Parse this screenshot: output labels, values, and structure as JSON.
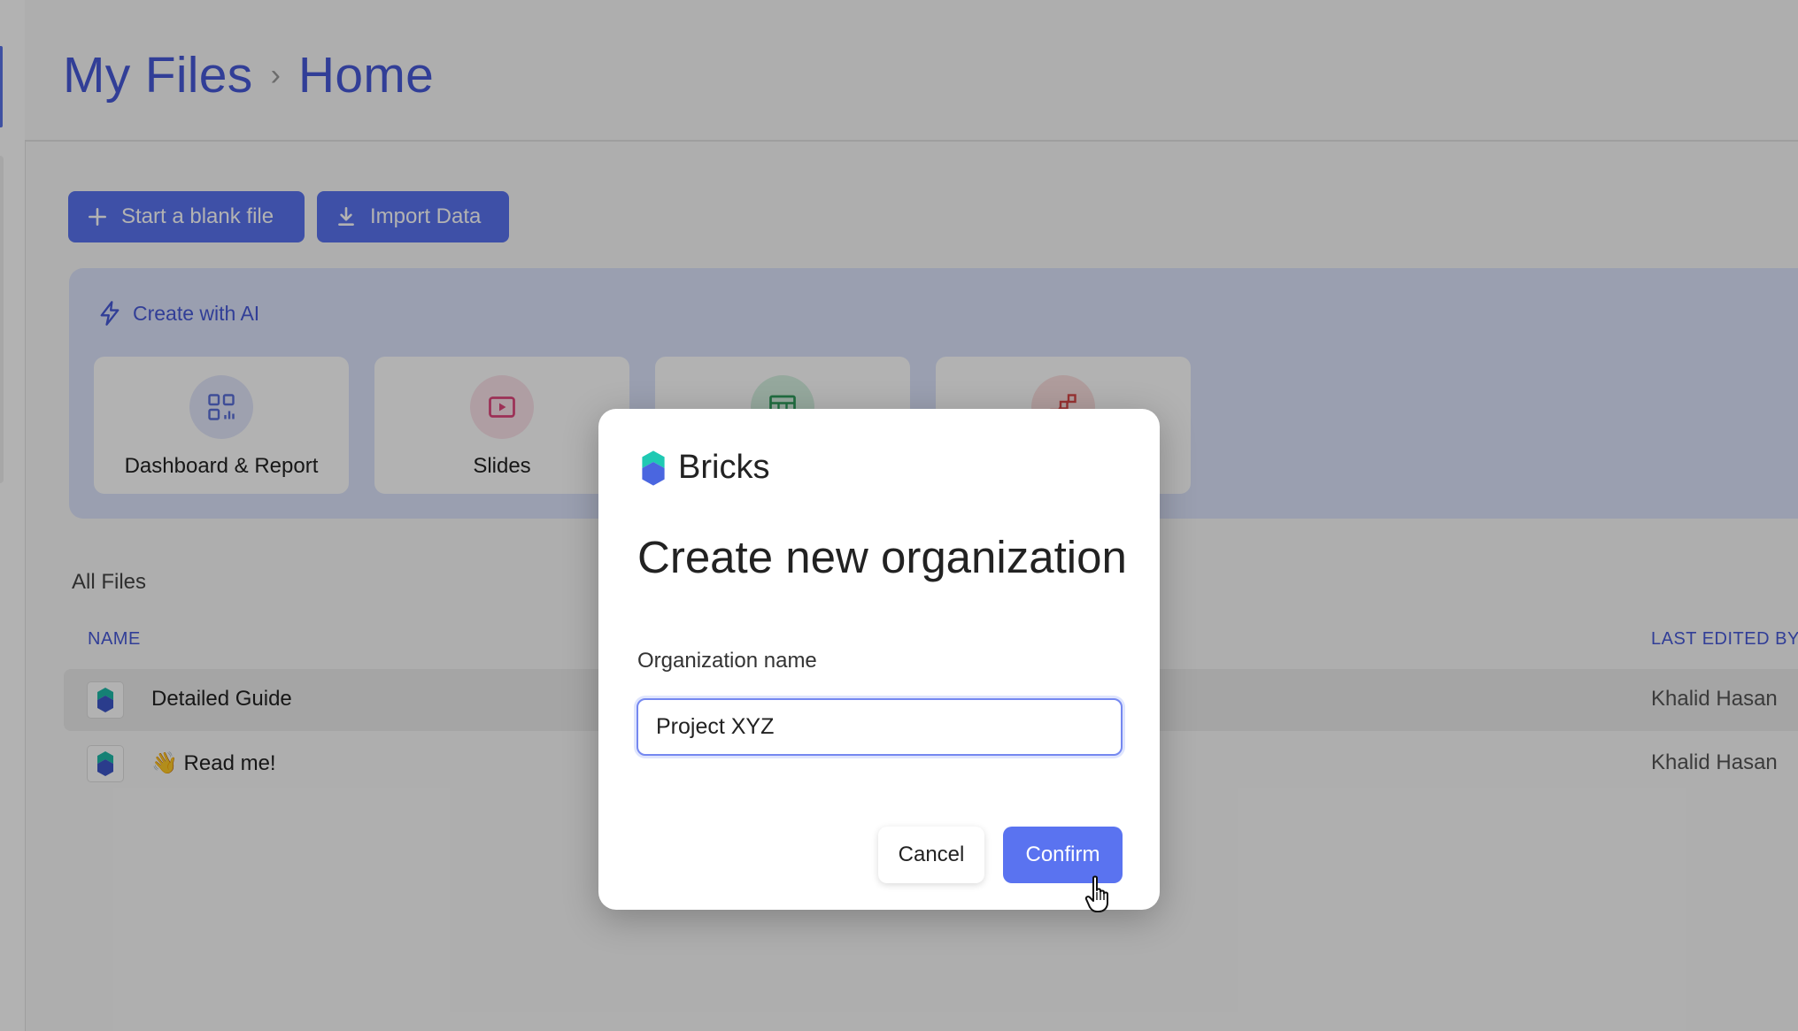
{
  "header": {
    "breadcrumb": [
      "My Files",
      "Home"
    ],
    "separator": "›"
  },
  "toolbar": {
    "blank_file_label": "Start a blank file",
    "import_label": "Import Data"
  },
  "ai_section": {
    "title": "Create with AI",
    "cards": [
      {
        "label": "Dashboard & Report",
        "icon": "dashboard-icon",
        "color": "#5a6fd8"
      },
      {
        "label": "Slides",
        "icon": "slides-icon",
        "color": "#e0457b"
      },
      {
        "label": "",
        "icon": "table-icon",
        "color": "#2e9c5c"
      },
      {
        "label": "",
        "icon": "flow-icon",
        "color": "#d94848"
      }
    ]
  },
  "files": {
    "section_title": "All Files",
    "columns": {
      "name": "NAME",
      "last_edited_by": "LAST EDITED BY"
    },
    "rows": [
      {
        "name": "Detailed Guide",
        "last_edited_by": "Khalid Hasan"
      },
      {
        "name": "👋 Read me!",
        "last_edited_by": "Khalid Hasan"
      }
    ]
  },
  "modal": {
    "brand": "Bricks",
    "title": "Create new organization",
    "field_label": "Organization name",
    "field_value": "Project XYZ",
    "cancel_label": "Cancel",
    "confirm_label": "Confirm"
  },
  "colors": {
    "accent": "#5a73f0",
    "accent_text": "#4759d8"
  }
}
